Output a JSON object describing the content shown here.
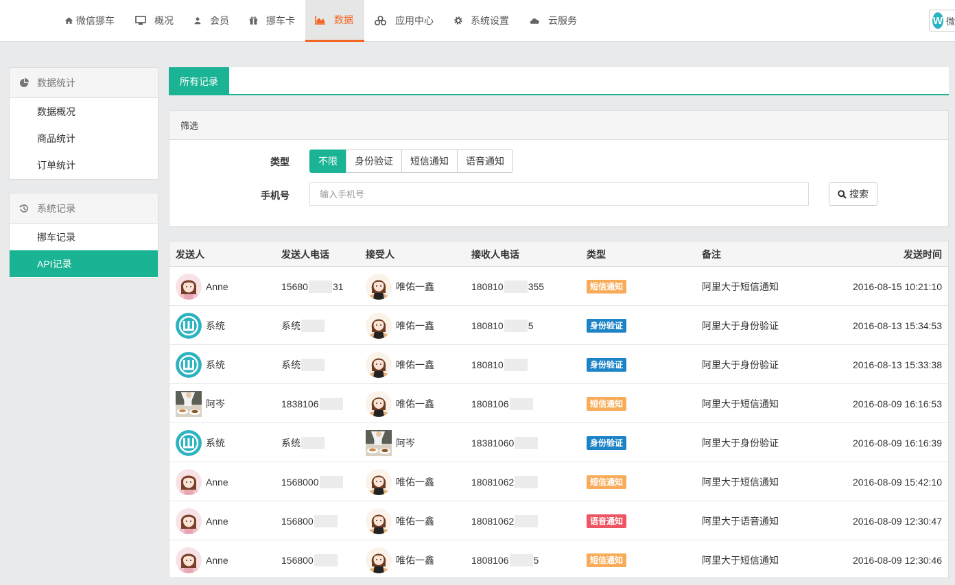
{
  "nav": {
    "items": [
      {
        "label": "微信挪车",
        "icon": "home-icon"
      },
      {
        "label": "概况",
        "icon": "monitor-icon"
      },
      {
        "label": "会员",
        "icon": "user-icon"
      },
      {
        "label": "挪车卡",
        "icon": "gift-icon"
      },
      {
        "label": "数据",
        "icon": "area-chart-icon",
        "active": true
      },
      {
        "label": "应用中心",
        "icon": "cubes-icon"
      },
      {
        "label": "系统设置",
        "icon": "gear-icon"
      },
      {
        "label": "云服务",
        "icon": "cloud-icon"
      }
    ],
    "brand_glyph": "W",
    "brand_partial": "微"
  },
  "sidebar": {
    "groups": [
      {
        "title": "数据统计",
        "icon": "pie-chart-icon",
        "items": [
          "数据概况",
          "商品统计",
          "订单统计"
        ]
      },
      {
        "title": "系统记录",
        "icon": "history-icon",
        "items": [
          "挪车记录",
          "API记录"
        ],
        "active_index": 1
      }
    ]
  },
  "tabs": {
    "active": "所有记录"
  },
  "filter": {
    "title": "筛选",
    "type_label": "类型",
    "type_options": [
      "不限",
      "身份验证",
      "短信通知",
      "语音通知"
    ],
    "type_selected": "不限",
    "phone_label": "手机号",
    "phone_placeholder": "输入手机号",
    "phone_value": "",
    "search_label": "搜索"
  },
  "table": {
    "headers": [
      "发送人",
      "发送人电话",
      "接受人",
      "接收人电话",
      "类型",
      "备注",
      "发送时间"
    ],
    "rows": [
      {
        "sender": "Anne",
        "sender_avatar": "girl",
        "sender_phone": "15680",
        "sender_phone_tail": "31",
        "receiver": "唯佑一鑫",
        "receiver_avatar": "girl2",
        "receiver_phone": "180810",
        "receiver_phone_tail": "355",
        "type": "短信通知",
        "type_kind": "sms",
        "note": "阿里大于短信通知",
        "time": "2016-08-15 10:21:10"
      },
      {
        "sender": "系统",
        "sender_avatar": "logo",
        "sender_phone": "系统",
        "sender_phone_tail": "",
        "receiver": "唯佑一鑫",
        "receiver_avatar": "girl2",
        "receiver_phone": "180810",
        "receiver_phone_tail": "5",
        "type": "身份验证",
        "type_kind": "id",
        "note": "阿里大于身份验证",
        "time": "2016-08-13 15:34:53"
      },
      {
        "sender": "系统",
        "sender_avatar": "logo",
        "sender_phone": "系统",
        "sender_phone_tail": "",
        "receiver": "唯佑一鑫",
        "receiver_avatar": "girl2",
        "receiver_phone": "180810",
        "receiver_phone_tail": "",
        "type": "身份验证",
        "type_kind": "id",
        "note": "阿里大于身份验证",
        "time": "2016-08-13 15:33:38"
      },
      {
        "sender": "阿岑",
        "sender_avatar": "photo",
        "sender_phone": "1838106",
        "sender_phone_tail": "",
        "receiver": "唯佑一鑫",
        "receiver_avatar": "girl2",
        "receiver_phone": "1808106",
        "receiver_phone_tail": "",
        "type": "短信通知",
        "type_kind": "sms",
        "note": "阿里大于短信通知",
        "time": "2016-08-09 16:16:53"
      },
      {
        "sender": "系统",
        "sender_avatar": "logo",
        "sender_phone": "系统",
        "sender_phone_tail": "",
        "receiver": "阿岑",
        "receiver_avatar": "photo",
        "receiver_phone": "18381060",
        "receiver_phone_tail": "",
        "type": "身份验证",
        "type_kind": "id",
        "note": "阿里大于身份验证",
        "time": "2016-08-09 16:16:39"
      },
      {
        "sender": "Anne",
        "sender_avatar": "girl",
        "sender_phone": "1568000",
        "sender_phone_tail": "",
        "receiver": "唯佑一鑫",
        "receiver_avatar": "girl2",
        "receiver_phone": "18081062",
        "receiver_phone_tail": "",
        "type": "短信通知",
        "type_kind": "sms",
        "note": "阿里大于短信通知",
        "time": "2016-08-09 15:42:10"
      },
      {
        "sender": "Anne",
        "sender_avatar": "girl",
        "sender_phone": "156800",
        "sender_phone_tail": "",
        "receiver": "唯佑一鑫",
        "receiver_avatar": "girl2",
        "receiver_phone": "18081062",
        "receiver_phone_tail": "",
        "type": "语音通知",
        "type_kind": "voice",
        "note": "阿里大于语音通知",
        "time": "2016-08-09 12:30:47"
      },
      {
        "sender": "Anne",
        "sender_avatar": "girl",
        "sender_phone": "156800",
        "sender_phone_tail": "",
        "receiver": "唯佑一鑫",
        "receiver_avatar": "girl2",
        "receiver_phone": "1808106",
        "receiver_phone_tail": "5",
        "type": "短信通知",
        "type_kind": "sms",
        "note": "阿里大于短信通知",
        "time": "2016-08-09 12:30:46"
      }
    ]
  },
  "colors": {
    "accent": "#1ab394",
    "nav_active": "#f26522",
    "sms": "#f8ac59",
    "id": "#1c84c6",
    "voice": "#ed5565",
    "logo": "#2bb3c0"
  }
}
